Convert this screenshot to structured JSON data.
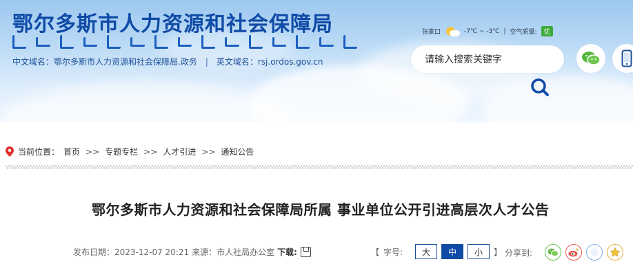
{
  "header": {
    "site_title": "鄂尔多斯市人力资源和社会保障局",
    "cn_domain_label": "中文域名：鄂尔多斯市人力资源和社会保障局.政务",
    "separator": "|",
    "en_domain_label": "英文域名：rsj.ordos.gov.cn",
    "weather": {
      "city": "张家口",
      "temperature": "-7℃ ~ -3℃",
      "divider": "|",
      "air_quality_label": "空气质量:",
      "air_quality_value": "优"
    },
    "search": {
      "placeholder": "请输入搜索关键字"
    }
  },
  "breadcrumb": {
    "label": "当前位置：",
    "items": [
      "首页",
      "专题专栏",
      "人才引进",
      "通知公告"
    ],
    "separator": ">>"
  },
  "article": {
    "title": "鄂尔多斯市人力资源和社会保障局所属 事业单位公开引进高层次人才公告",
    "publish_label": "发布日期：2023-12-07 20:21",
    "source_label": "来源：市人社局办公室",
    "download_label": "下载:"
  },
  "font_size": {
    "open_bracket": "【",
    "label": "字号:",
    "options": [
      "大",
      "中",
      "小"
    ],
    "selected": "中",
    "close_bracket": "】"
  },
  "share": {
    "label": "分享到:"
  },
  "colors": {
    "brand_blue": "#0f4aa6",
    "air_quality_green": "#3daa3a",
    "location_red": "#e0322f"
  }
}
